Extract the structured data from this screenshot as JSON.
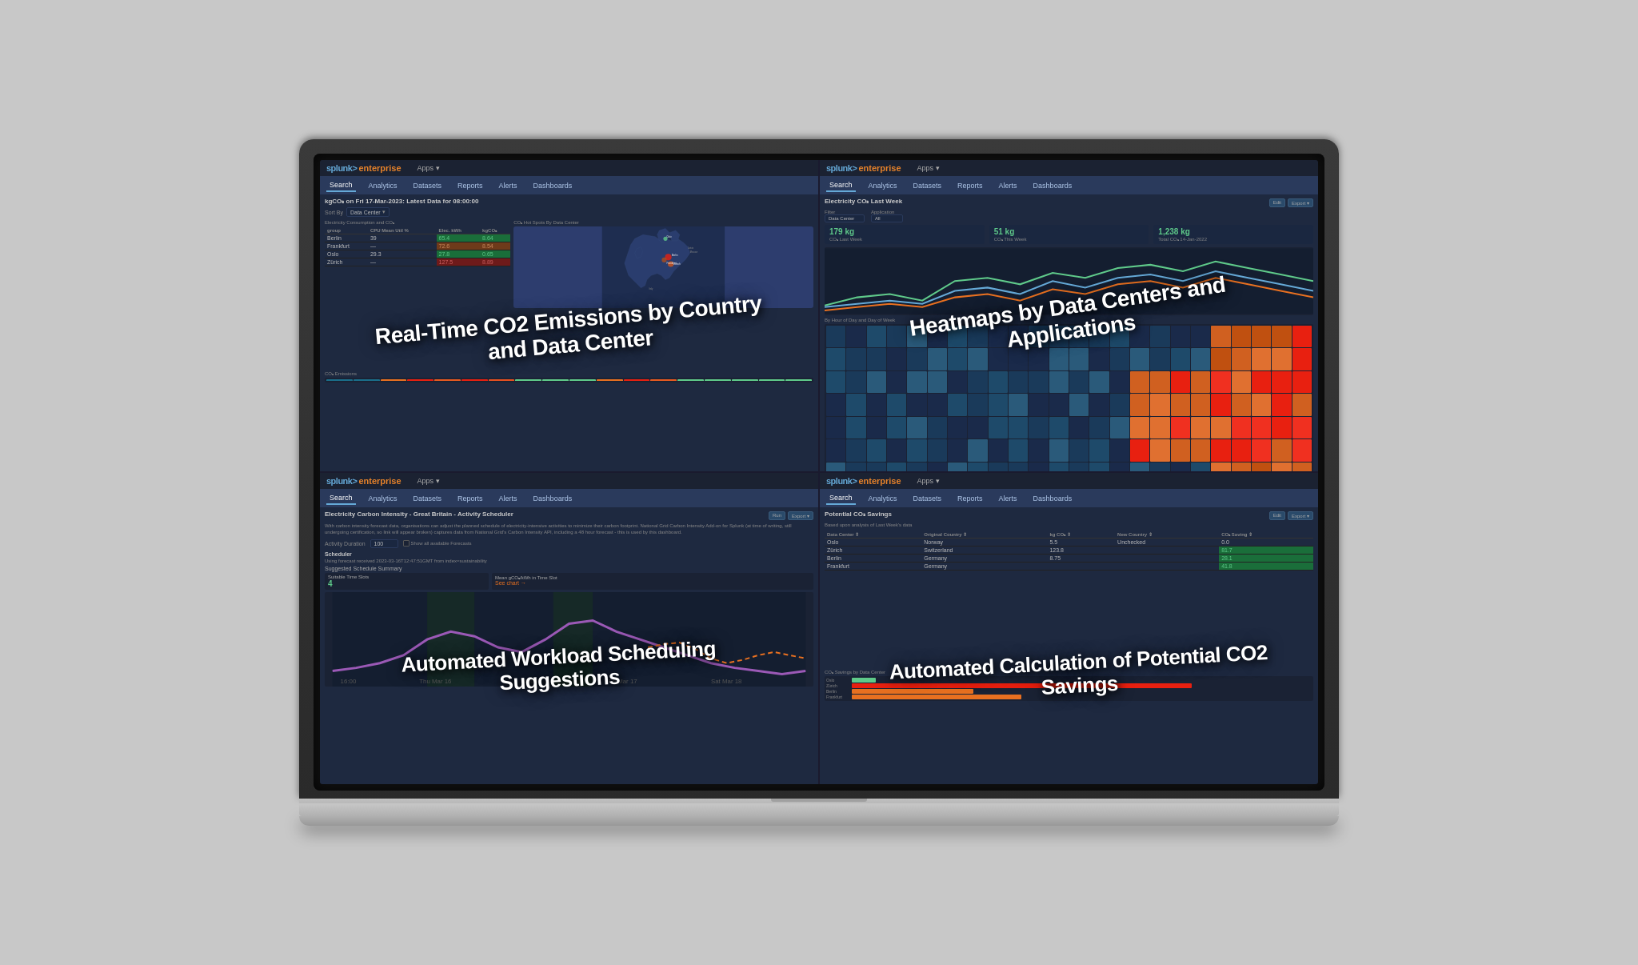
{
  "laptop": {
    "panels": [
      {
        "id": "panel-1",
        "logo": "splunk>enterprise",
        "logo_splunk": "splunk>",
        "logo_enterprise": "enterprise",
        "apps_label": "Apps ▾",
        "nav_items": [
          "Search",
          "Analytics",
          "Datasets",
          "Reports",
          "Alerts",
          "Dashboards"
        ],
        "active_nav": "Search",
        "title": "kgCO₂ on Fri 17-Mar-2023: Latest Data for 08:00:00",
        "overlay_text": "Real-Time CO2 Emissions by Country and Data Center",
        "metric_1": "",
        "chart_type": "map_bar"
      },
      {
        "id": "panel-2",
        "logo_splunk": "splunk>",
        "logo_enterprise": "enterprise",
        "apps_label": "Apps ▾",
        "nav_items": [
          "Search",
          "Analytics",
          "Datasets",
          "Reports",
          "Alerts",
          "Dashboards"
        ],
        "active_nav": "Search",
        "title": "Electricity CO₂ Last Week",
        "overlay_text": "Heatmaps by Data Centers and Applications",
        "metric_co2_last": "179 kg",
        "metric_co2_this": "51 kg",
        "metric_total": "1,238 kg",
        "chart_type": "heatmap"
      },
      {
        "id": "panel-3",
        "logo_splunk": "splunk>",
        "logo_enterprise": "enterprise",
        "apps_label": "Apps ▾",
        "nav_items": [
          "Search",
          "Analytics",
          "Datasets",
          "Reports",
          "Alerts",
          "Dashboards"
        ],
        "active_nav": "Search",
        "title": "Electricity Carbon Intensity - Great Britain - Activity Scheduler",
        "overlay_text": "Automated Workload Scheduling Suggestions",
        "chart_type": "schedule"
      },
      {
        "id": "panel-4",
        "logo_splunk": "splunk>",
        "logo_enterprise": "enterprise",
        "apps_label": "Apps ▾",
        "nav_items": [
          "Search",
          "Analytics",
          "Datasets",
          "Reports",
          "Alerts",
          "Dashboards"
        ],
        "active_nav": "Search",
        "title": "Potential CO₂ Savings",
        "overlay_text": "Automated Calculation of Potential CO2 Savings",
        "chart_type": "savings_table",
        "table_headers": [
          "Data Center",
          "Original Country",
          "kg CO₂",
          "New Country",
          "CO₂ Saving"
        ],
        "table_rows": [
          [
            "Oslo",
            "Norway",
            "5.5",
            "Unchecked",
            "0.0"
          ],
          [
            "Zürich",
            "Switzerland",
            "123.8",
            "",
            "81.7"
          ],
          [
            "Berlin",
            "Germany",
            "8.75",
            "",
            "28.1"
          ],
          [
            "Frankfurt",
            "Germany",
            "",
            "",
            "41.8"
          ]
        ]
      }
    ]
  },
  "colors": {
    "splunk_blue": "#65a9d7",
    "splunk_orange": "#e8832a",
    "nav_bg": "#2a3a5c",
    "panel_bg": "#1b2232",
    "green": "#5fca8a",
    "red": "#e85a5a",
    "orange": "#e8832a",
    "heat_low": "#1a3a5a",
    "heat_med": "#c05010",
    "heat_high": "#e82010"
  }
}
